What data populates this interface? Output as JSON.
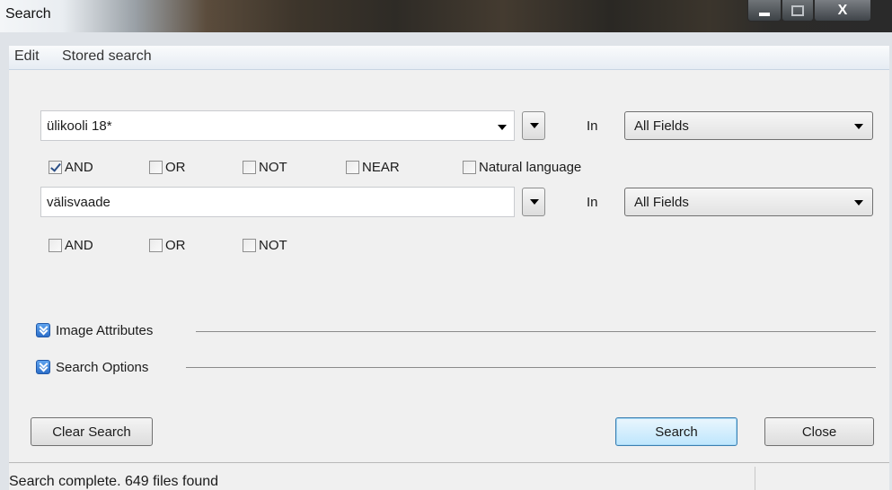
{
  "window": {
    "title": "Search"
  },
  "menu": {
    "items": [
      "Edit",
      "Stored search"
    ]
  },
  "query1": {
    "text": "ülikooli 18*",
    "in_label": "In",
    "field": "All Fields"
  },
  "operators1": [
    {
      "label": "AND",
      "checked": true
    },
    {
      "label": "OR",
      "checked": false
    },
    {
      "label": "NOT",
      "checked": false
    },
    {
      "label": "NEAR",
      "checked": false
    },
    {
      "label": "Natural language",
      "checked": false
    }
  ],
  "query2": {
    "text": "välisvaade",
    "in_label": "In",
    "field": "All Fields"
  },
  "operators2": [
    {
      "label": "AND",
      "checked": false
    },
    {
      "label": "OR",
      "checked": false
    },
    {
      "label": "NOT",
      "checked": false
    }
  ],
  "sections": {
    "image_attributes": "Image Attributes",
    "search_options": "Search Options"
  },
  "buttons": {
    "clear": "Clear Search",
    "search": "Search",
    "close": "Close"
  },
  "status": {
    "text": "Search complete. 649 files found"
  }
}
